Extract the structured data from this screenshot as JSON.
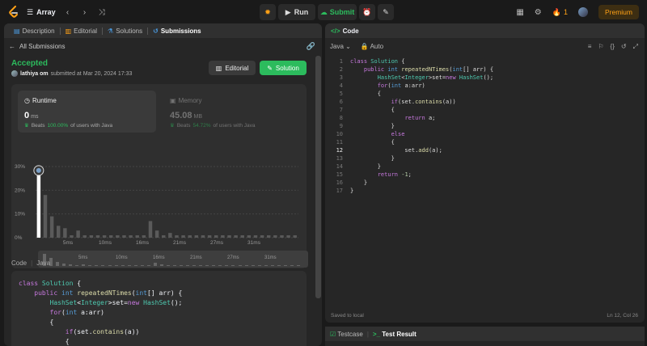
{
  "header": {
    "problem_list_label": "Array",
    "run_label": "Run",
    "submit_label": "Submit",
    "streak": "1",
    "premium_label": "Premium"
  },
  "left_tabs": [
    "Description",
    "Editorial",
    "Solutions",
    "Submissions"
  ],
  "submission": {
    "back_label": "All Submissions",
    "status": "Accepted",
    "user": "lathiya om",
    "submitted_text": "submitted at Mar 20, 2024 17:33",
    "editorial_button": "Editorial",
    "solution_button": "Solution"
  },
  "runtime": {
    "title": "Runtime",
    "value": "0",
    "unit": "ms",
    "beats_label": "Beats",
    "beats_value": "100.00%",
    "beats_suffix": "of users with Java"
  },
  "memory": {
    "title": "Memory",
    "value": "45.08",
    "unit": "MB",
    "beats_label": "Beats",
    "beats_value": "54.72%",
    "beats_suffix": "of users with Java"
  },
  "chart_data": {
    "type": "bar",
    "y_tick_labels": [
      "30%",
      "20%",
      "10%",
      "0%"
    ],
    "ylim": [
      0,
      30
    ],
    "x_tick_labels": [
      "5ms",
      "10ms",
      "16ms",
      "21ms",
      "27ms",
      "31ms"
    ],
    "values": [
      29,
      18,
      9,
      5,
      4,
      1,
      3,
      1,
      1,
      1,
      1,
      1,
      1,
      1,
      1,
      1,
      1,
      7,
      3,
      1,
      2,
      1,
      1,
      1,
      1,
      1,
      1,
      1,
      1,
      1,
      1,
      1,
      1,
      1,
      1,
      1,
      1,
      1,
      1,
      1
    ],
    "highlight_index": 0
  },
  "code_section": {
    "code_label": "Code",
    "lang_label": "Java"
  },
  "submitted_code": [
    "class Solution {",
    "    public int repeatedNTimes(int[] arr) {",
    "        HashSet<Integer>set=new HashSet();",
    "        for(int a:arr)",
    "        {",
    "            if(set.contains(a))",
    "            {",
    "                return a;"
  ],
  "editor": {
    "tab_label": "Code",
    "language": "Java",
    "mode": "Auto",
    "current_line": 12,
    "lines": [
      "class Solution {",
      "    public int repeatedNTimes(int[] arr) {",
      "        HashSet<Integer>set=new HashSet();",
      "        for(int a:arr)",
      "        {",
      "            if(set.contains(a))",
      "            {",
      "                return a;",
      "            }",
      "            else",
      "            {",
      "                set.add(a);",
      "            }",
      "        }",
      "        return -1;",
      "    }",
      "}"
    ],
    "saved_text": "Saved to local",
    "cursor_text": "Ln 12, Col 26"
  },
  "bottom_tabs": {
    "testcase": "Testcase",
    "test_result": "Test Result"
  }
}
